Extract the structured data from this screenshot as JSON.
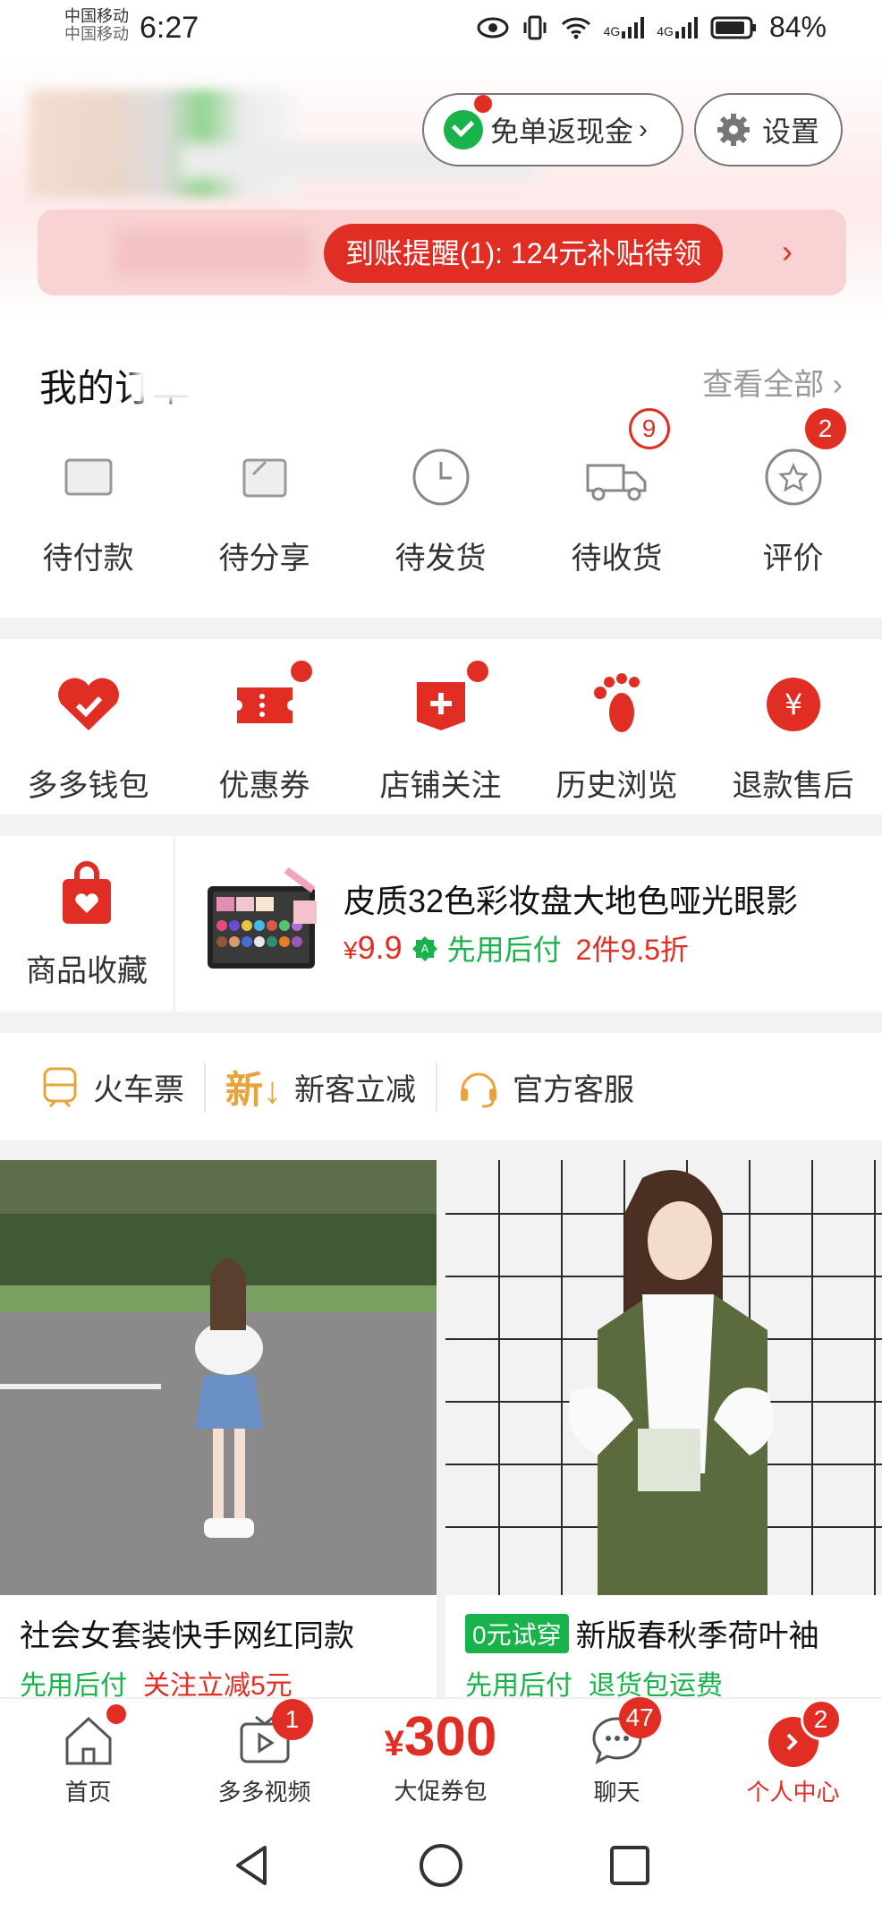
{
  "status": {
    "carrier": "中国移动",
    "carrier2": "中国移动",
    "time": "6:27",
    "network1": "4G",
    "network2": "4G",
    "battery": "84%"
  },
  "header": {
    "cashback_label": "免单返现金",
    "settings_label": "设置",
    "notice_text": "到账提醒(1): 124元补贴待领"
  },
  "orders": {
    "title": "我的订单",
    "view_all": "查看全部",
    "items": [
      {
        "label": "待付款",
        "icon": "wallet-icon",
        "badge": ""
      },
      {
        "label": "待分享",
        "icon": "share-icon",
        "badge": ""
      },
      {
        "label": "待发货",
        "icon": "clock-icon",
        "badge": ""
      },
      {
        "label": "待收货",
        "icon": "truck-icon",
        "badge": "9"
      },
      {
        "label": "评价",
        "icon": "review-icon",
        "badge": "2"
      }
    ]
  },
  "tools": {
    "items": [
      {
        "label": "多多钱包",
        "icon": "heart-wallet-icon"
      },
      {
        "label": "优惠券",
        "icon": "coupon-icon"
      },
      {
        "label": "店铺关注",
        "icon": "store-follow-icon"
      },
      {
        "label": "历史浏览",
        "icon": "footprint-icon"
      },
      {
        "label": "退款售后",
        "icon": "refund-icon"
      }
    ]
  },
  "favorites": {
    "label": "商品收藏",
    "product_title": "皮质32色彩妆盘大地色哑光眼影",
    "price_symbol": "¥",
    "price": "9.9",
    "pay_later": "先用后付",
    "discount": "2件9.5折"
  },
  "links": [
    {
      "label": "火车票",
      "icon": "train-icon"
    },
    {
      "label": "新客立减",
      "icon": "new-customer-icon"
    },
    {
      "label": "官方客服",
      "icon": "headset-icon"
    }
  ],
  "products": [
    {
      "title": "社会女套装快手网红同款",
      "tag": "",
      "pay_later": "先用后付",
      "promo": "关注立减5元"
    },
    {
      "title": "新版春秋季荷叶袖",
      "tag": "0元试穿",
      "pay_later": "先用后付",
      "promo": "退货包运费"
    }
  ],
  "tabbar": {
    "home": "首页",
    "video": "多多视频",
    "video_badge": "1",
    "promo_amount": "300",
    "promo_symbol": "¥",
    "promo_label": "大促券包",
    "chat": "聊天",
    "chat_badge": "47",
    "profile": "个人中心",
    "profile_badge": "2"
  },
  "colors": {
    "brand_red": "#e02e24",
    "green": "#19b34b"
  }
}
